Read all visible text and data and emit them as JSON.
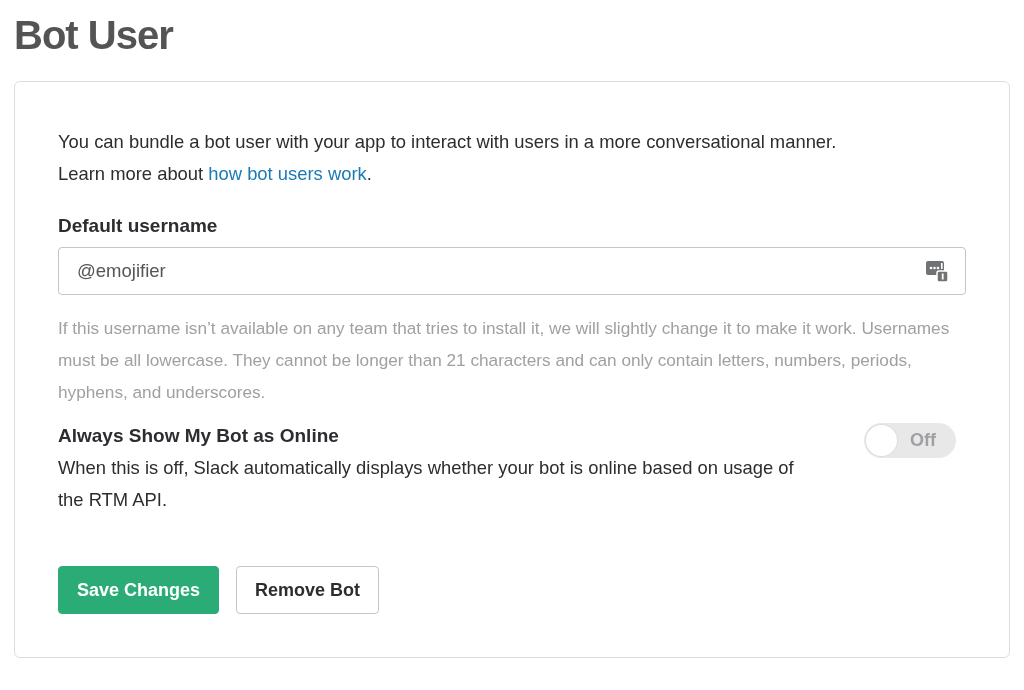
{
  "page_title": "Bot User",
  "description": {
    "text": "You can bundle a bot user with your app to interact with users in a more conversational manner.",
    "more": "Learn more about ",
    "link": "how bot users work",
    "after": "."
  },
  "username": {
    "label": "Default username",
    "value": "@emojifier",
    "hint": "If this username isn’t available on any team that tries to install it, we will slightly change it to make it work. Usernames must be all lowercase. They cannot be longer than 21 characters and can only contain letters, numbers, periods, hyphens, and underscores."
  },
  "always_online": {
    "title": "Always Show My Bot as Online",
    "description": "When this is off, Slack automatically displays whether your bot is online based on usage of the RTM API.",
    "on": false,
    "state_label": "Off"
  },
  "buttons": [
    {
      "kind": "primary",
      "label": "Save Changes"
    },
    {
      "kind": "secondary",
      "label": "Remove Bot"
    }
  ]
}
